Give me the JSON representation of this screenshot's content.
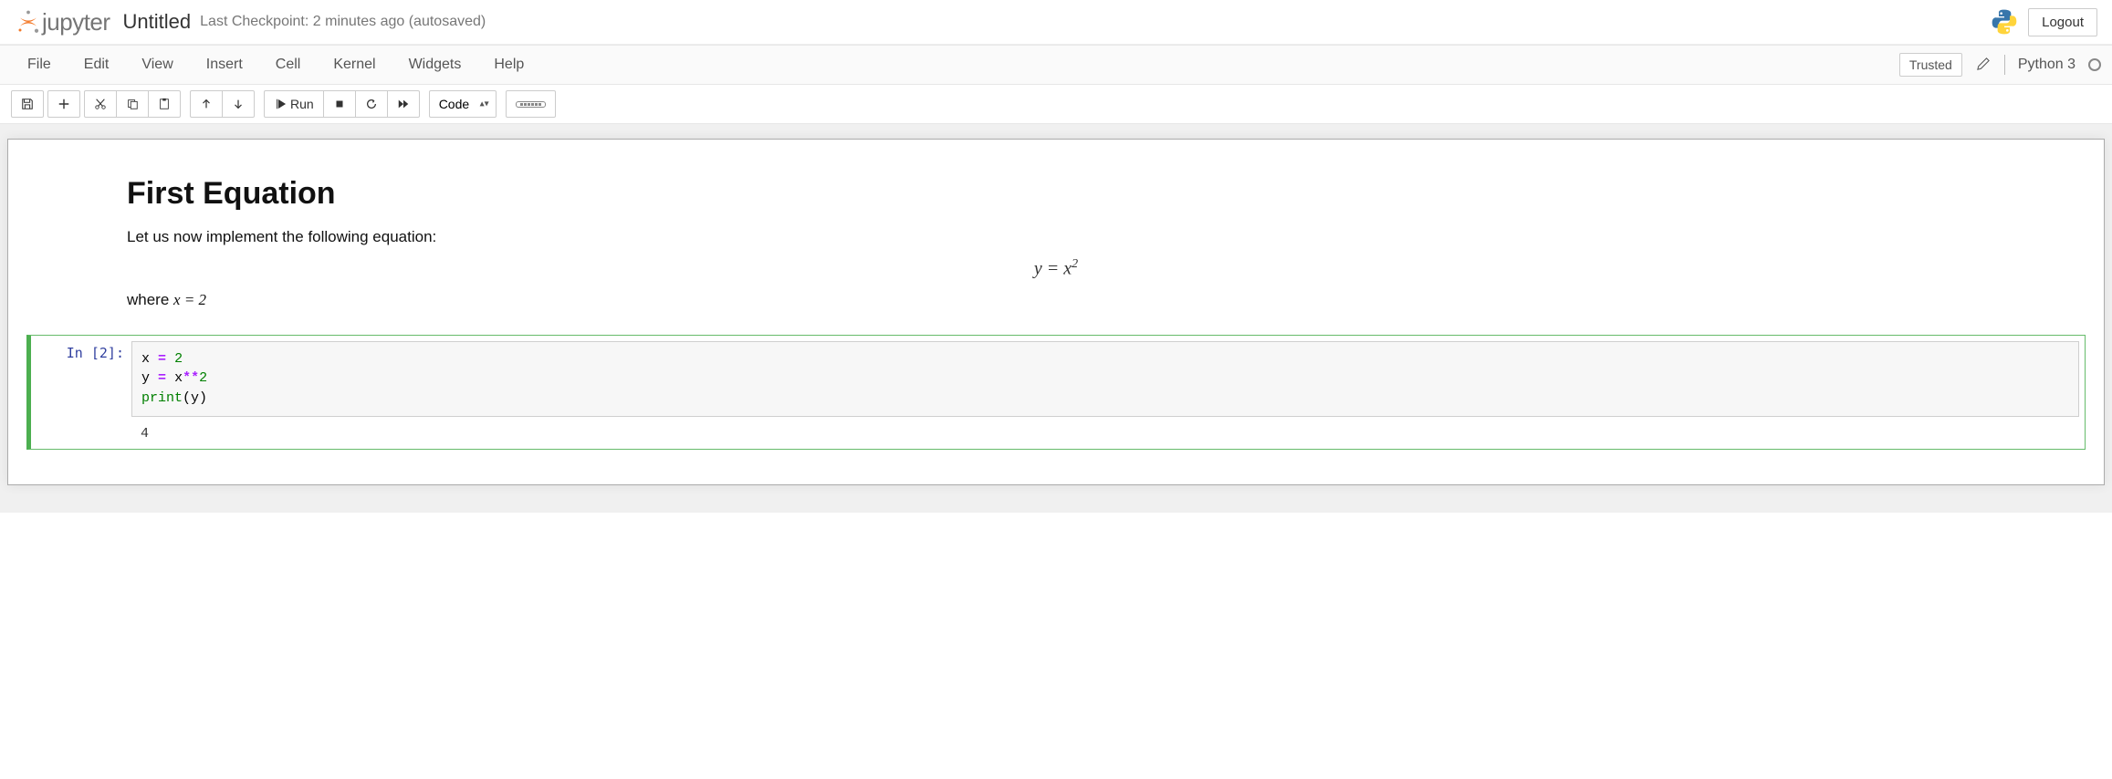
{
  "header": {
    "logo_text": "jupyter",
    "notebook_name": "Untitled",
    "checkpoint": "Last Checkpoint: 2 minutes ago  (autosaved)",
    "logout": "Logout"
  },
  "menubar": {
    "items": [
      "File",
      "Edit",
      "View",
      "Insert",
      "Cell",
      "Kernel",
      "Widgets",
      "Help"
    ],
    "trusted": "Trusted",
    "kernel": "Python 3"
  },
  "toolbar": {
    "run_label": "Run",
    "cell_type": "Code"
  },
  "cells": {
    "markdown": {
      "heading": "First Equation",
      "intro": "Let us now implement the following equation:",
      "equation_lhs": "y",
      "equation_eq": " = ",
      "equation_rhs_base": "x",
      "equation_rhs_sup": "2",
      "where_prefix": "where ",
      "where_math": "x = 2"
    },
    "code": {
      "prompt": "In [2]:",
      "line1": {
        "var1": "x",
        "op": "=",
        "num": "2"
      },
      "line2": {
        "var1": "y",
        "op": "=",
        "var2": "x",
        "op2": "**",
        "num": "2"
      },
      "line3": {
        "fn": "print",
        "arg": "y"
      },
      "output": "4"
    }
  }
}
